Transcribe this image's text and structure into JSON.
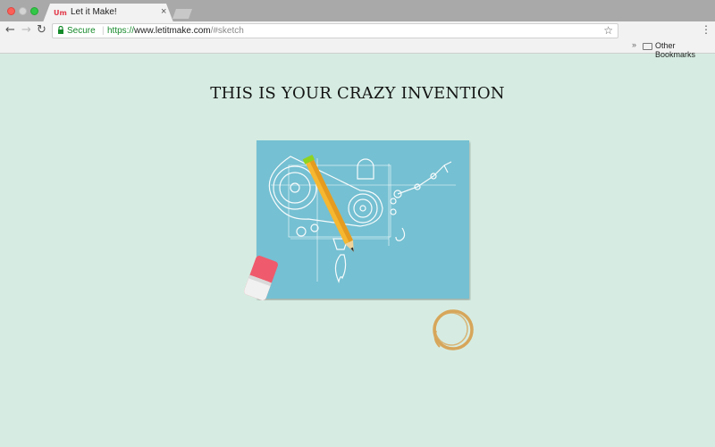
{
  "browser": {
    "tab_title": "Let it Make!",
    "tab_favicon": "Um",
    "tab_close": "×",
    "security_label": "Secure",
    "url_protocol": "https://",
    "url_host": "www.letitmake.com",
    "url_path": "/#sketch",
    "bookmarks_overflow": "»",
    "bookmarks_folder": "Other Bookmarks"
  },
  "page": {
    "headline": "THIS IS YOUR CRAZY INVENTION"
  },
  "colors": {
    "background": "#d6ece2",
    "blueprint": "#75c0d2",
    "pencil": "#f6b731",
    "eraser": "#ef5b6c",
    "coffee_ring": "#d7a65a"
  }
}
